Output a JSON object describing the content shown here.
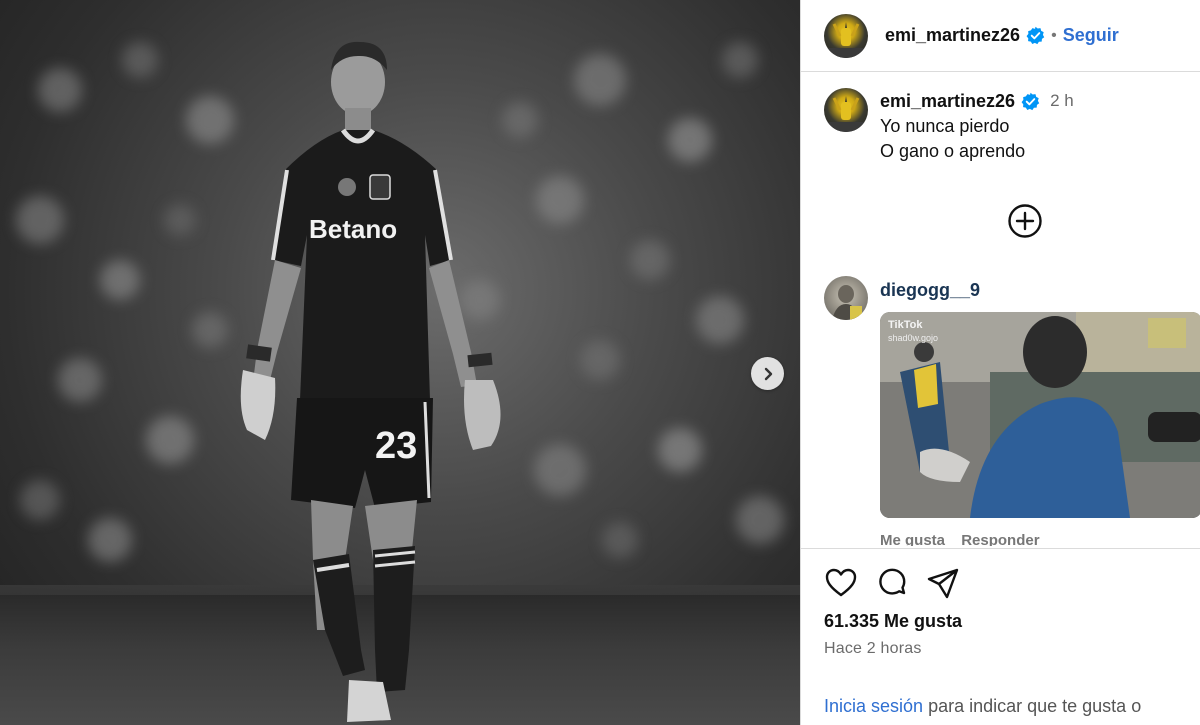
{
  "post": {
    "jersey_sponsor": "Betano",
    "jersey_number": "23"
  },
  "header": {
    "username": "emi_martinez26",
    "separator": "•",
    "follow_label": "Seguir"
  },
  "caption": {
    "username": "emi_martinez26",
    "time": "2 h",
    "lines": [
      "Yo nunca pierdo",
      "O gano o aprendo"
    ]
  },
  "comments": [
    {
      "username": "diegogg__9",
      "gif_label": "TikTok",
      "gif_handle": "shad0w.gojo",
      "actions": [
        "Me gusta",
        "Responder"
      ]
    }
  ],
  "footer": {
    "likes": "61.335 Me gusta",
    "ago": "Hace 2 horas",
    "login_link": "Inicia sesión",
    "login_text": " para indicar que te gusta o"
  },
  "icons": {
    "verified": "verified-badge-icon",
    "next": "chevron-right-icon",
    "more": "plus-circle-icon",
    "like": "heart-icon",
    "comment": "comment-icon",
    "share": "share-icon"
  },
  "colors": {
    "link": "#2f6fd1",
    "verified": "#0095f6",
    "muted": "#6b6b6b"
  }
}
